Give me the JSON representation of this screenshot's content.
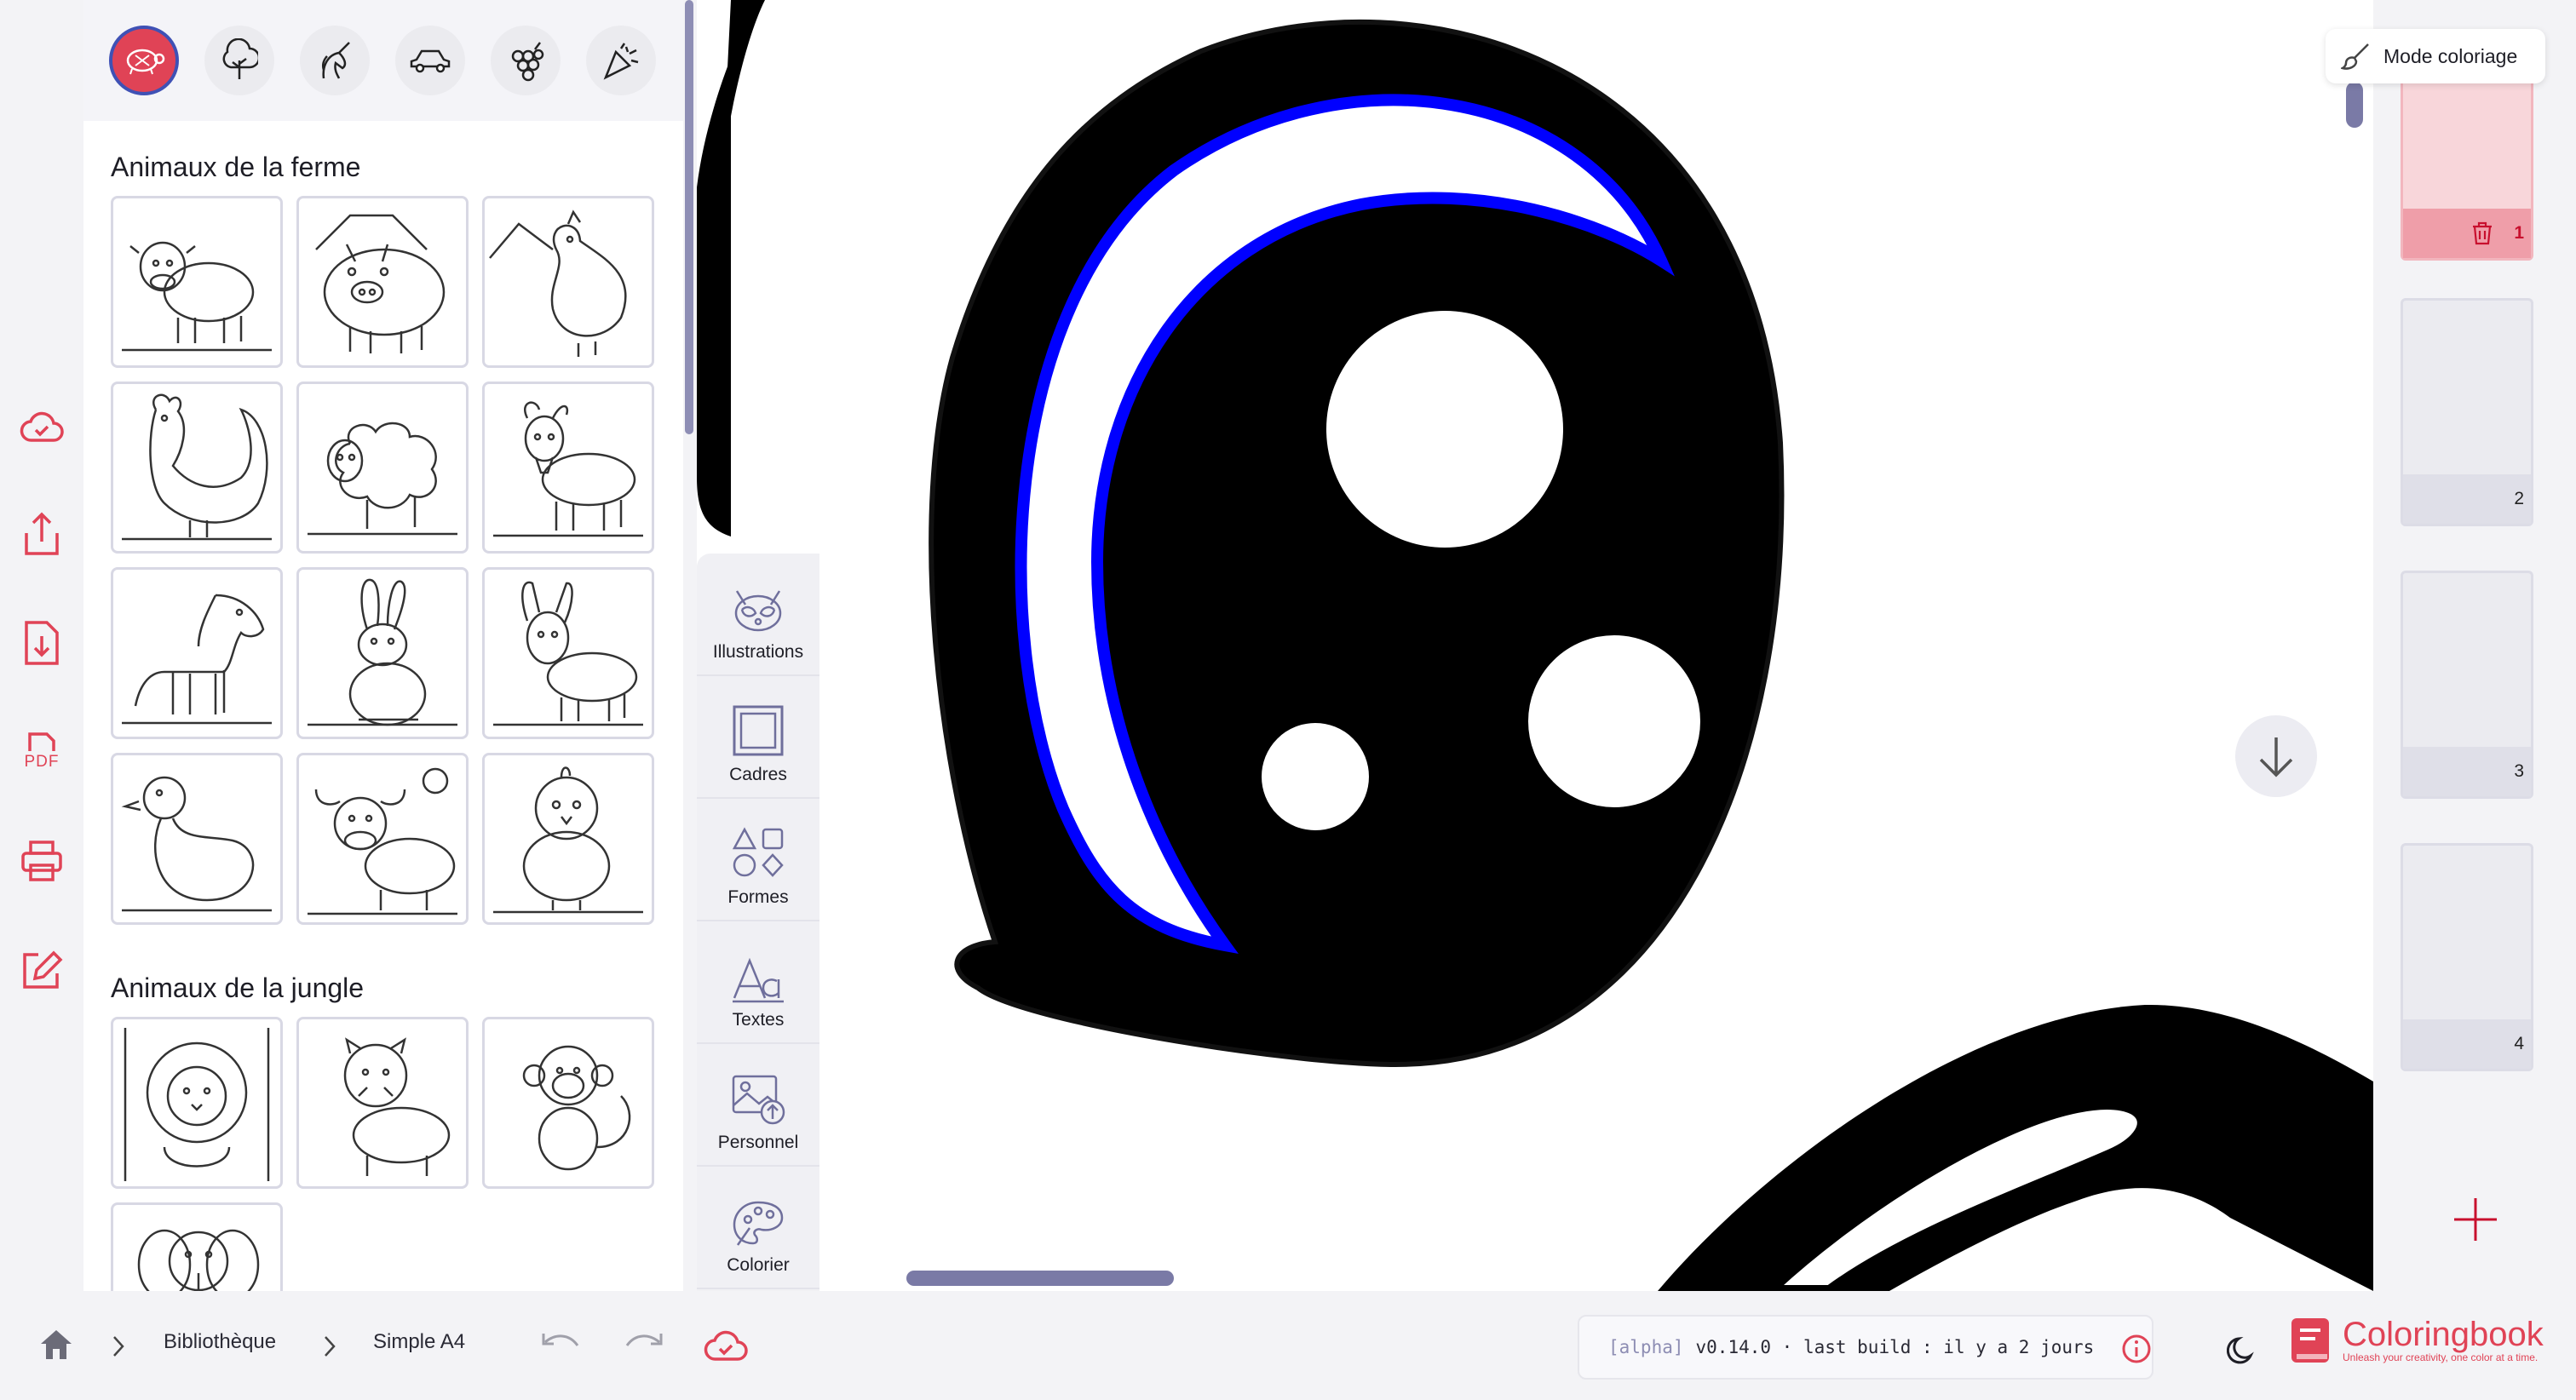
{
  "library": {
    "categories": [
      {
        "name": "Animaux",
        "icon": "turtle-icon",
        "active": true
      },
      {
        "name": "Nature",
        "icon": "tree-icon"
      },
      {
        "name": "Fantastique",
        "icon": "unicorn-icon"
      },
      {
        "name": "Véhicules",
        "icon": "car-icon"
      },
      {
        "name": "Fruits",
        "icon": "grapes-icon"
      },
      {
        "name": "Fête",
        "icon": "party-popper-icon"
      }
    ],
    "sections": [
      {
        "title": "Animaux de la ferme"
      },
      {
        "title": "Animaux de la jungle"
      }
    ]
  },
  "tools": [
    {
      "label": "Illustrations",
      "icon": "raccoon-icon"
    },
    {
      "label": "Cadres",
      "icon": "frame-icon"
    },
    {
      "label": "Formes",
      "icon": "shapes-icon"
    },
    {
      "label": "Textes",
      "icon": "text-icon"
    },
    {
      "label": "Personnel",
      "icon": "image-upload-icon"
    },
    {
      "label": "Colorier",
      "icon": "palette-icon"
    }
  ],
  "rail": [
    {
      "icon": "cloud-check-icon"
    },
    {
      "icon": "share-icon"
    },
    {
      "icon": "download-icon"
    },
    {
      "icon": "pdf-icon",
      "label": "PDF"
    },
    {
      "icon": "print-icon"
    },
    {
      "icon": "edit-icon"
    }
  ],
  "mode_button": {
    "label": "Mode coloriage"
  },
  "pages": [
    {
      "number": "1",
      "active": true
    },
    {
      "number": "2"
    },
    {
      "number": "3"
    },
    {
      "number": "4"
    }
  ],
  "breadcrumb": {
    "library": "Bibliothèque",
    "document": "Simple A4"
  },
  "version": {
    "tag": "[alpha]",
    "text": "v0.14.0 · last build : il y a 2 jours"
  },
  "brand": {
    "name": "Coloringbook",
    "tagline": "Unleash your creativity, one color at a time.",
    "color": "#e04356"
  },
  "colors": {
    "accent": "#e04356",
    "indigo": "#3f51b5",
    "scroll": "#7a7aa6"
  }
}
